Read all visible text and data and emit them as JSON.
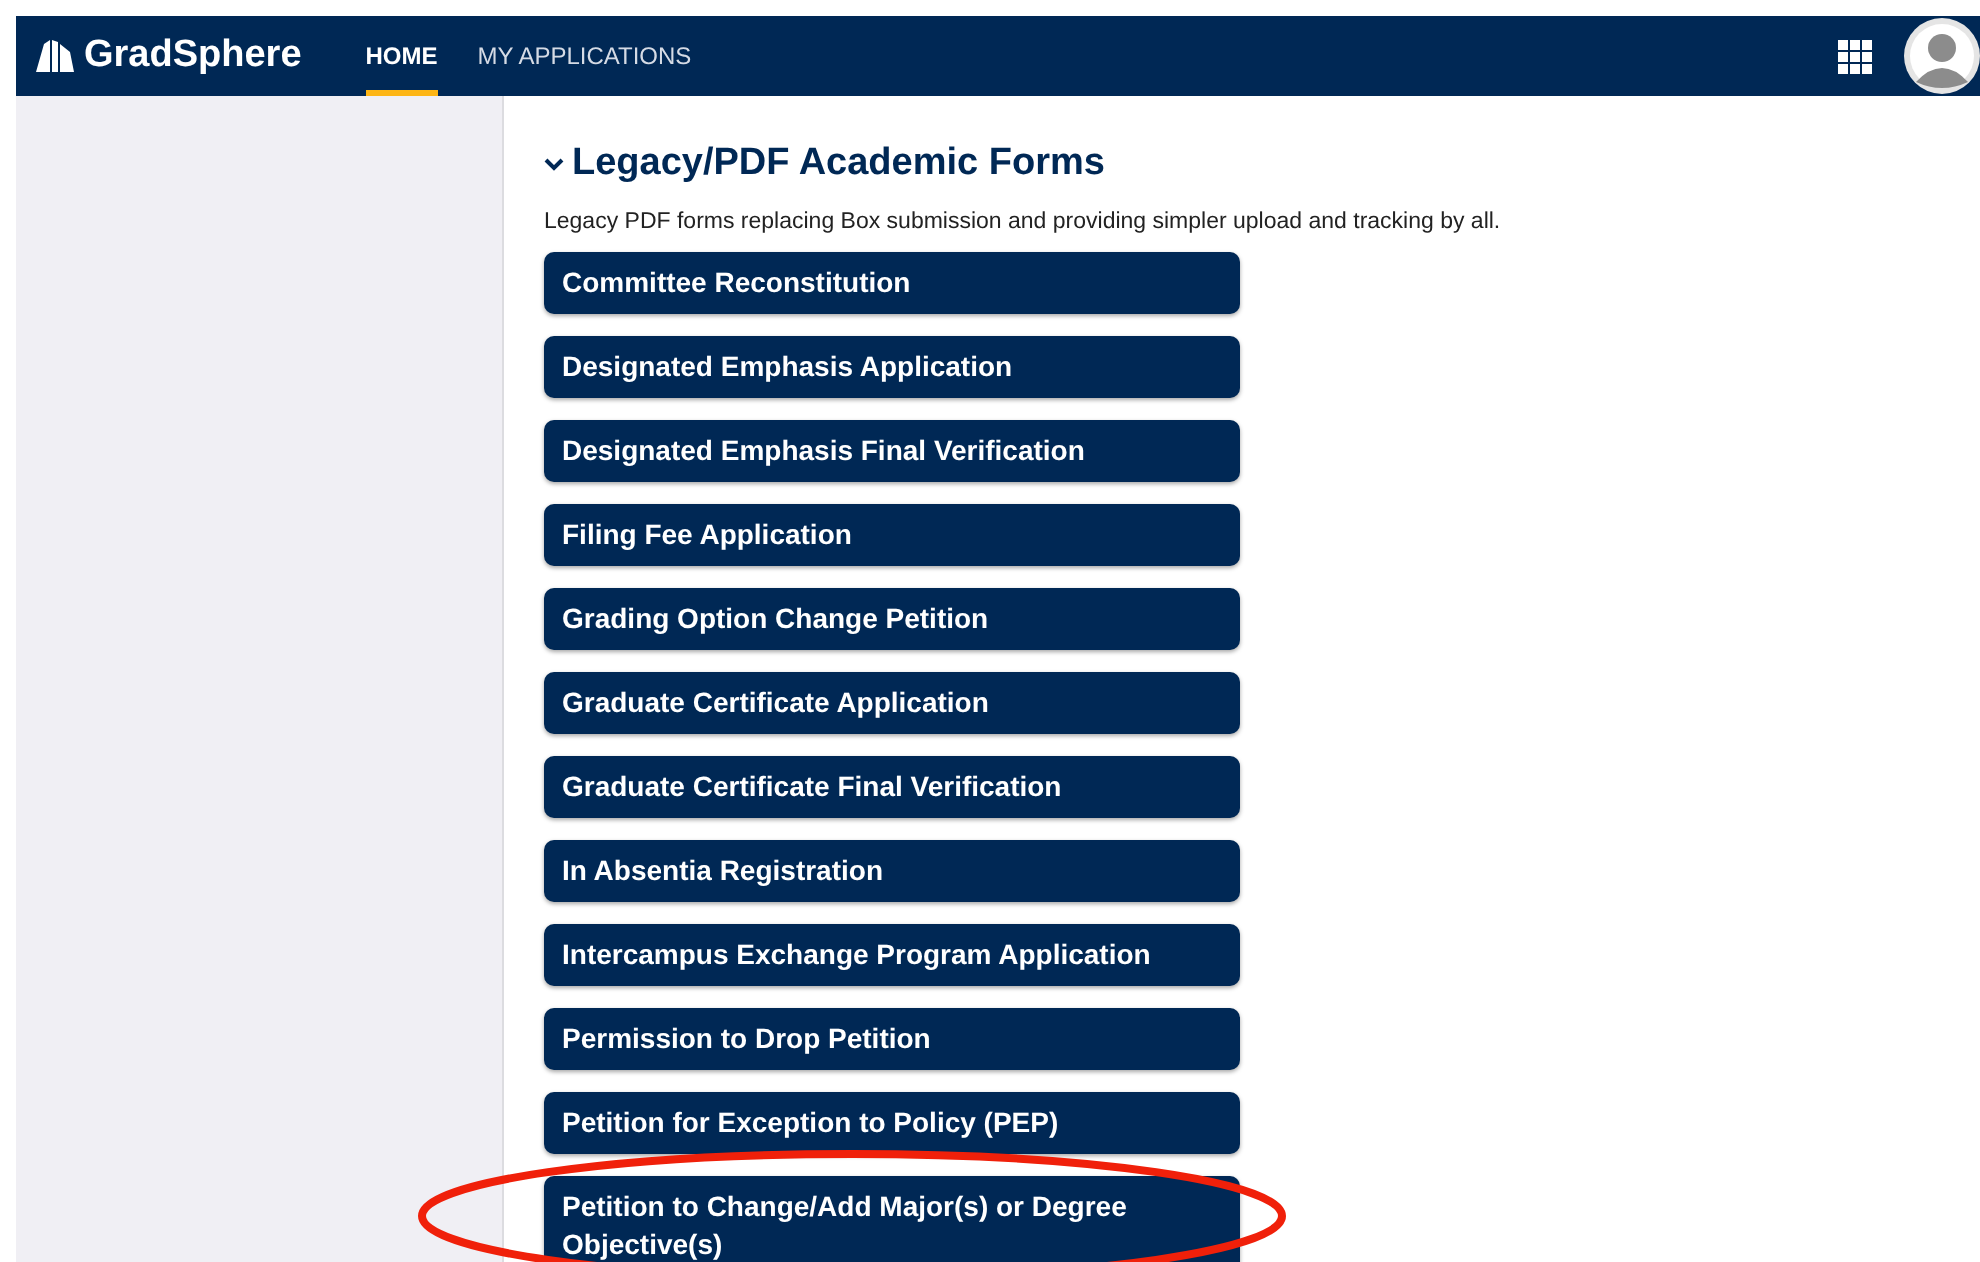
{
  "header": {
    "logo": "GradSphere",
    "nav": [
      {
        "label": "HOME",
        "selected": true
      },
      {
        "label": "MY APPLICATIONS",
        "selected": false
      }
    ]
  },
  "section": {
    "title": "Legacy/PDF Academic Forms",
    "expanded": true,
    "description": "Legacy PDF forms replacing Box submission and providing simpler upload and tracking by all.",
    "forms": [
      {
        "label": "Committee Reconstitution",
        "circled": false
      },
      {
        "label": "Designated Emphasis Application",
        "circled": false
      },
      {
        "label": "Designated Emphasis Final Verification",
        "circled": false
      },
      {
        "label": "Filing Fee Application",
        "circled": false
      },
      {
        "label": "Grading Option Change Petition",
        "circled": false
      },
      {
        "label": "Graduate Certificate Application",
        "circled": false
      },
      {
        "label": "Graduate Certificate Final Verification",
        "circled": false
      },
      {
        "label": "In Absentia Registration",
        "circled": false
      },
      {
        "label": "Intercampus Exchange Program Application",
        "circled": false
      },
      {
        "label": "Permission to Drop Petition",
        "circled": false
      },
      {
        "label": "Petition for Exception to Policy (PEP)",
        "circled": false
      },
      {
        "label": "Petition to Change/Add Major(s) or Degree Objective(s)",
        "circled": true
      }
    ]
  }
}
